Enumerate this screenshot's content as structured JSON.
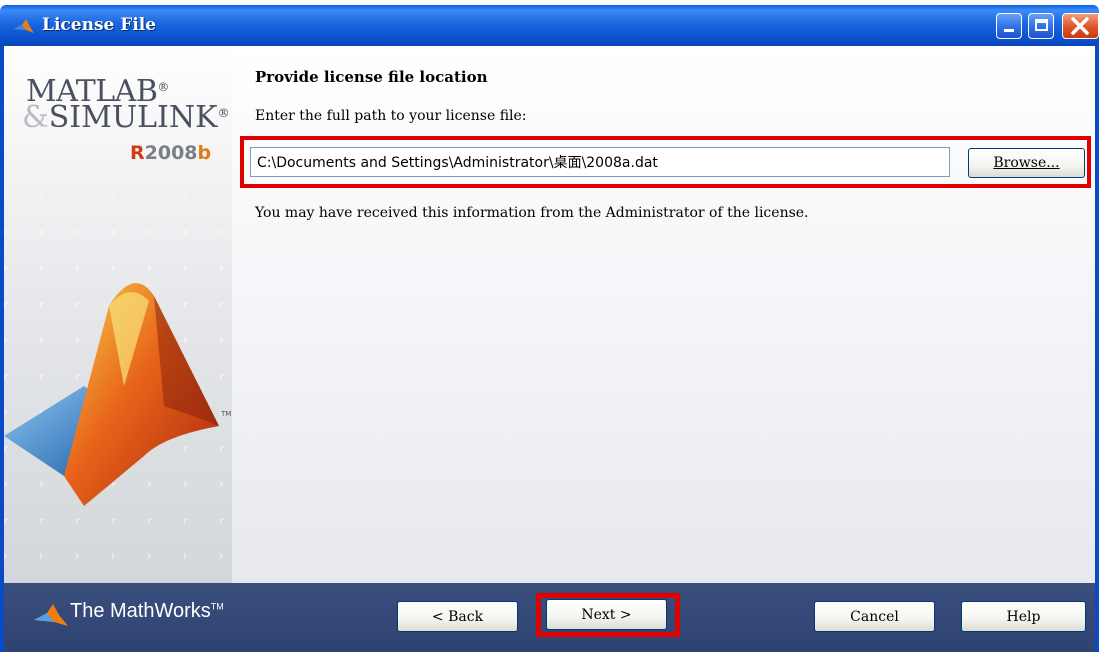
{
  "window": {
    "title": "License File",
    "controls": {
      "minimize": "minimize-icon",
      "maximize": "maximize-icon",
      "close": "close-icon"
    }
  },
  "branding": {
    "logo_line1": "MATLAB",
    "logo_line2": "SIMULINK",
    "registered": "®",
    "release_prefix": "R",
    "release_number": "2008",
    "release_suffix": "b",
    "trademark": "TM",
    "company": "The MathWorks"
  },
  "main": {
    "heading": "Provide license file location",
    "prompt": "Enter the full path to your license file:",
    "license_path": "C:\\Documents and Settings\\Administrator\\桌面\\2008a.dat",
    "browse_label": "Browse...",
    "info": "You may have received this information from the Administrator of the license."
  },
  "footer": {
    "back_label": "< Back",
    "next_label": "Next >",
    "cancel_label": "Cancel",
    "help_label": "Help"
  },
  "colors": {
    "titlebar": "#1b66df",
    "highlight": "#e10000",
    "footer_bg": "#2f4372"
  }
}
